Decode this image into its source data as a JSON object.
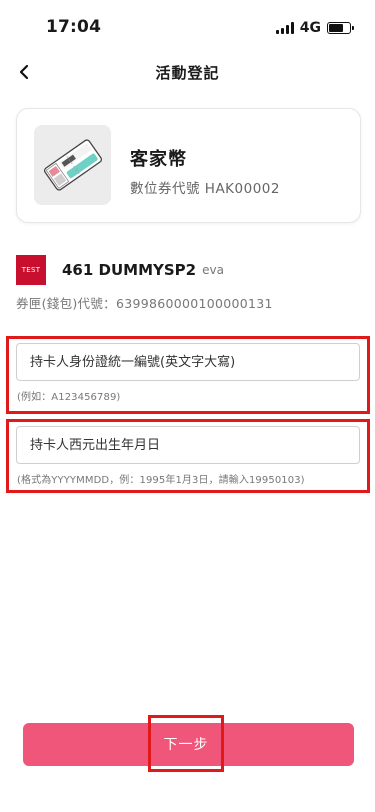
{
  "status_bar": {
    "time": "17:04",
    "network": "4G"
  },
  "nav": {
    "title": "活動登記",
    "back_icon": "chevron-left-icon"
  },
  "coupon": {
    "name": "客家幣",
    "code": "數位券代號 HAK00002",
    "thumbnail": "voucher-ticket-image"
  },
  "wallet": {
    "logo_text": "TEST",
    "name": "461 DUMMYSP2",
    "user": "eva",
    "id_text": "券匣(錢包)代號：6399860000100000131"
  },
  "form": {
    "id_field": {
      "placeholder": "持卡人身份證統一編號(英文字大寫)",
      "value": "",
      "hint": "(例如：A123456789)"
    },
    "birth_field": {
      "placeholder": "持卡人西元出生年月日",
      "value": "",
      "hint": "(格式為YYYYMMDD，例：1995年1月3日，請輸入19950103)"
    }
  },
  "next_button": {
    "label": "下一步"
  },
  "colors": {
    "primary": "#f0557a",
    "highlight": "#e01a1a",
    "wallet_logo": "#c8102e"
  }
}
